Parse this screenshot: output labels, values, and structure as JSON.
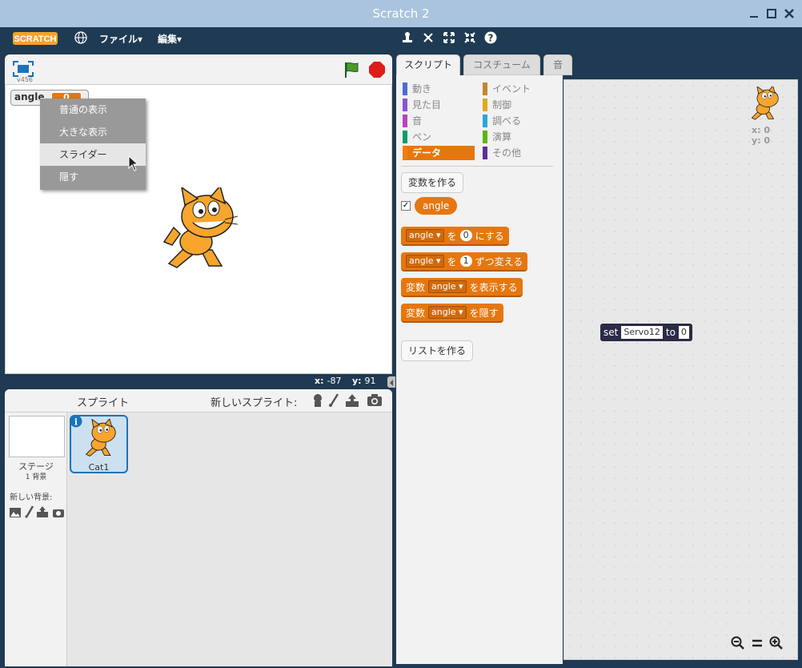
{
  "window": {
    "title": "Scratch 2"
  },
  "menubar": {
    "logo_text": "SCRATCH",
    "file_label": "ファイル▾",
    "edit_label": "編集▾"
  },
  "stage": {
    "version": "v456",
    "mouse_x_label": "x:",
    "mouse_x_value": "-87",
    "mouse_y_label": "y:",
    "mouse_y_value": "91",
    "monitor": {
      "name": "angle",
      "value": "0"
    }
  },
  "context_menu": {
    "items": [
      "普通の表示",
      "大きな表示",
      "スライダー",
      "隠す"
    ],
    "highlighted": "スライダー"
  },
  "sprites_panel": {
    "title": "スプライト",
    "new_sprite_label": "新しいスプライト:",
    "stage_label": "ステージ",
    "stage_sub": "1 背景",
    "new_backdrop_label": "新しい背景:",
    "sprites": [
      {
        "name": "Cat1"
      }
    ]
  },
  "tabs": [
    "スクリプト",
    "コスチューム",
    "音"
  ],
  "categories": {
    "left": [
      {
        "label": "動き",
        "color": "#4a6cd4"
      },
      {
        "label": "見た目",
        "color": "#8a55d7"
      },
      {
        "label": "音",
        "color": "#bb42c3"
      },
      {
        "label": "ペン",
        "color": "#0e9a6c"
      },
      {
        "label": "データ",
        "color": "#ee7d16"
      }
    ],
    "right": [
      {
        "label": "イベント",
        "color": "#c88330"
      },
      {
        "label": "制御",
        "color": "#e1a91a"
      },
      {
        "label": "調べる",
        "color": "#2ca5e2"
      },
      {
        "label": "演算",
        "color": "#5cb712"
      },
      {
        "label": "その他",
        "color": "#632d99"
      }
    ],
    "active": "データ"
  },
  "palette": {
    "make_variable": "変数を作る",
    "variable_name": "angle",
    "block_set": {
      "var": "angle",
      "mid": "を",
      "value": "0",
      "suffix": "にする"
    },
    "block_change": {
      "var": "angle",
      "mid": "を",
      "value": "1",
      "suffix": "ずつ変える"
    },
    "block_show": {
      "prefix": "変数",
      "var": "angle",
      "suffix": "を表示する"
    },
    "block_hide": {
      "prefix": "変数",
      "var": "angle",
      "suffix": "を隠す"
    },
    "make_list": "リストを作る"
  },
  "scripts_area": {
    "sprite_x_label": "x: 0",
    "sprite_y_label": "y: 0",
    "block": {
      "word": "set",
      "field": "Servo12",
      "to": "to",
      "value": "0"
    }
  }
}
